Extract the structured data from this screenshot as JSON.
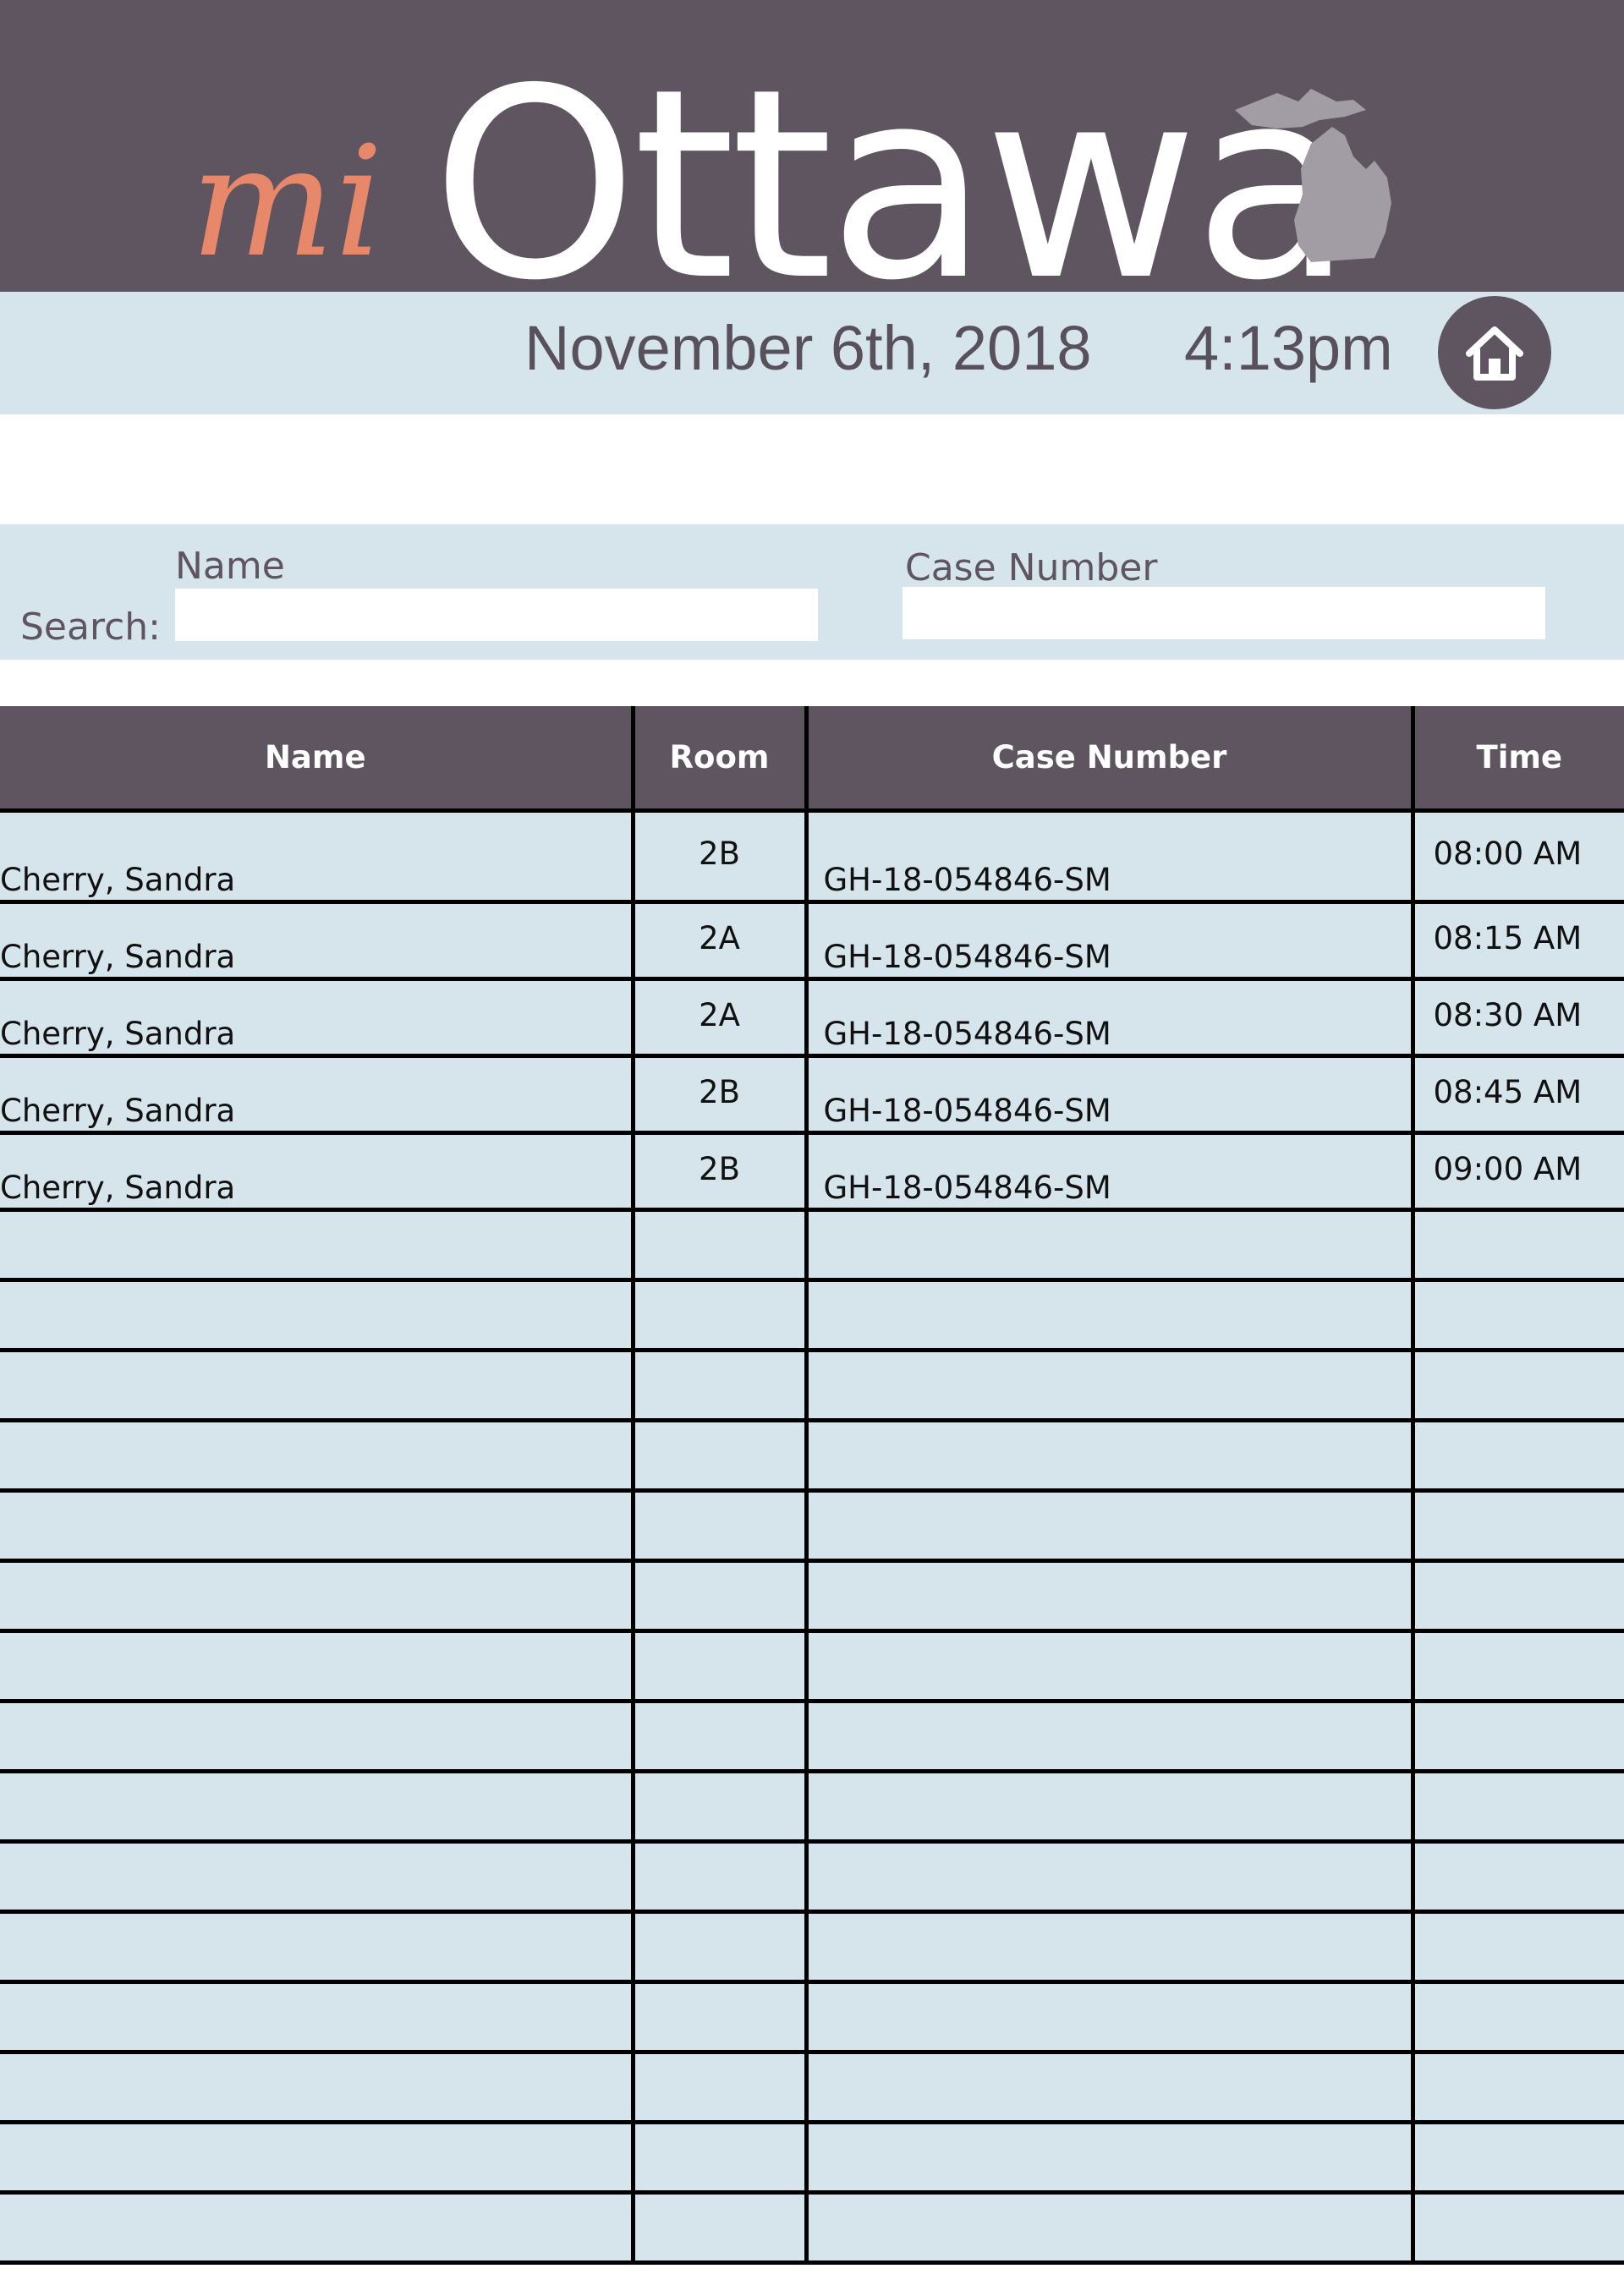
{
  "header": {
    "logo_prefix": "mi",
    "logo_name": "Ottawa",
    "logo_icon": "michigan-state-icon",
    "colors": {
      "bar": "#5e5560",
      "accent": "#e8886b",
      "light": "#d6e5ec"
    }
  },
  "datebar": {
    "date": "November 6th, 2018",
    "time": "4:13pm",
    "home_icon": "home-icon"
  },
  "search": {
    "label": "Search:",
    "name_label": "Name",
    "name_value": "",
    "case_label": "Case Number",
    "case_value": ""
  },
  "table": {
    "columns": [
      "Name",
      "Room",
      "Case Number",
      "Time"
    ],
    "rows": [
      {
        "name": "Cherry, Sandra",
        "room": "2B",
        "case": "GH-18-054846-SM",
        "time": "08:00 AM"
      },
      {
        "name": "Cherry, Sandra",
        "room": "2A",
        "case": "GH-18-054846-SM",
        "time": "08:15 AM"
      },
      {
        "name": "Cherry, Sandra",
        "room": "2A",
        "case": "GH-18-054846-SM",
        "time": "08:30 AM"
      },
      {
        "name": "Cherry, Sandra",
        "room": "2B",
        "case": "GH-18-054846-SM",
        "time": "08:45 AM"
      },
      {
        "name": "Cherry, Sandra",
        "room": "2B",
        "case": "GH-18-054846-SM",
        "time": "09:00 AM"
      }
    ],
    "empty_row_count": 15
  }
}
